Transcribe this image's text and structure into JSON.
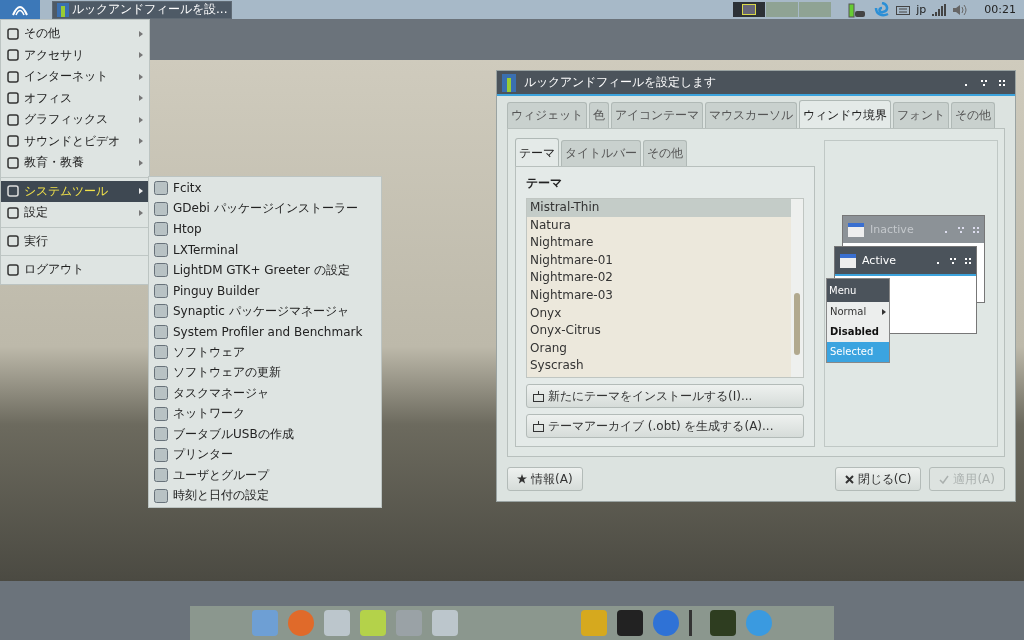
{
  "top_panel": {
    "tasks": [
      {
        "title": "ルックアンドフィールを設...",
        "selected": true
      }
    ],
    "workspaces": [
      {
        "selected": true
      },
      {
        "selected": false
      },
      {
        "selected": false
      }
    ],
    "keyboard_layout": "jp",
    "clock": "00:21"
  },
  "main_menu": {
    "sections": [
      {
        "items": [
          {
            "label": "その他",
            "kind": "submenu",
            "selected": false
          },
          {
            "label": "アクセサリ",
            "kind": "submenu",
            "selected": false
          },
          {
            "label": "インターネット",
            "kind": "submenu",
            "selected": false
          },
          {
            "label": "オフィス",
            "kind": "submenu",
            "selected": false
          },
          {
            "label": "グラフィックス",
            "kind": "submenu",
            "selected": false
          },
          {
            "label": "サウンドとビデオ",
            "kind": "submenu",
            "selected": false
          },
          {
            "label": "教育・教養",
            "kind": "submenu",
            "selected": false
          }
        ]
      },
      {
        "items": [
          {
            "label": "システムツール",
            "kind": "submenu",
            "selected": true
          },
          {
            "label": "設定",
            "kind": "submenu",
            "selected": false
          }
        ]
      },
      {
        "items": [
          {
            "label": "実行",
            "kind": "command",
            "selected": false
          }
        ]
      },
      {
        "items": [
          {
            "label": "ログアウト",
            "kind": "command",
            "selected": false
          }
        ]
      }
    ]
  },
  "submenu": {
    "items": [
      "Fcitx",
      "GDebi パッケージインストーラー",
      "Htop",
      "LXTerminal",
      "LightDM GTK+ Greeter の設定",
      "Pinguy Builder",
      "Synaptic パッケージマネージャ",
      "System Profiler and Benchmark",
      "ソフトウェア",
      "ソフトウェアの更新",
      "タスクマネージャ",
      "ネットワーク",
      "ブータブルUSBの作成",
      "プリンター",
      "ユーザとグループ",
      "時刻と日付の設定"
    ]
  },
  "dialog": {
    "title": "ルックアンドフィールを設定します",
    "tabs": [
      {
        "label": "ウィジェット",
        "selected": false
      },
      {
        "label": "色",
        "selected": false
      },
      {
        "label": "アイコンテーマ",
        "selected": false
      },
      {
        "label": "マウスカーソル",
        "selected": false
      },
      {
        "label": "ウィンドウ境界",
        "selected": true
      },
      {
        "label": "フォント",
        "selected": false
      },
      {
        "label": "その他",
        "selected": false
      }
    ],
    "subtabs": [
      {
        "label": "テーマ",
        "selected": true
      },
      {
        "label": "タイトルバー",
        "selected": false
      },
      {
        "label": "その他",
        "selected": false
      }
    ],
    "section_label": "テーマ",
    "themes": [
      {
        "name": "Mistral-Thin",
        "selected": true
      },
      {
        "name": "Natura",
        "selected": false
      },
      {
        "name": "Nightmare",
        "selected": false
      },
      {
        "name": "Nightmare-01",
        "selected": false
      },
      {
        "name": "Nightmare-02",
        "selected": false
      },
      {
        "name": "Nightmare-03",
        "selected": false
      },
      {
        "name": "Onyx",
        "selected": false
      },
      {
        "name": "Onyx-Citrus",
        "selected": false
      },
      {
        "name": "Orang",
        "selected": false
      },
      {
        "name": "Syscrash",
        "selected": false
      }
    ],
    "theme_buttons": [
      "新たにテーマをインストールする(I)...",
      "テーマアーカイブ (.obt) を生成する(A)..."
    ],
    "preview": {
      "inactive_title": "Inactive",
      "active_title": "Active",
      "menu_title": "Menu",
      "menu_items": [
        {
          "label": "Normal",
          "kind": "normal"
        },
        {
          "label": "Disabled",
          "kind": "disabled"
        },
        {
          "label": "Selected",
          "kind": "selected"
        }
      ]
    },
    "about_button": "情報(A)",
    "close_button": {
      "label": "閉じる(C)",
      "disabled": false
    },
    "apply_button": {
      "label": "適用(A)",
      "disabled": true
    }
  }
}
